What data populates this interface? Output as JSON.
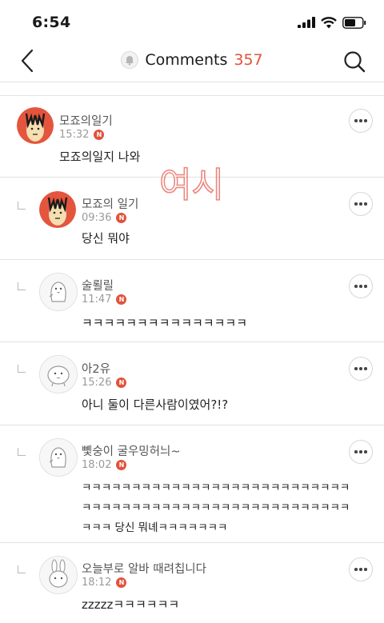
{
  "status": {
    "time": "6:54"
  },
  "header": {
    "title": "Comments",
    "count": "357"
  },
  "overlay_text": "여시",
  "comments": [
    {
      "nick": "모죠의일기",
      "time": "15:32",
      "text": "모죠의일지 나와",
      "reply": false,
      "avatar": "red-character"
    },
    {
      "nick": "모죠의 일기",
      "time": "09:36",
      "text": "당신 뭐야",
      "reply": true,
      "avatar": "red-character"
    },
    {
      "nick": "술뢸릴",
      "time": "11:47",
      "text": "ㅋㅋㅋㅋㅋㅋㅋㅋㅋㅋㅋㅋㅋㅋㅋ",
      "reply": true,
      "avatar": "penguin"
    },
    {
      "nick": "아2유",
      "time": "15:26",
      "text": "아니 둘이 다른사람이였어?!?",
      "reply": true,
      "avatar": "blob"
    },
    {
      "nick": "뼻숭이 굴우밍허늬~",
      "time": "18:02",
      "lines": [
        "ㅋㅋㅋㅋㅋㅋㅋㅋㅋㅋㅋㅋㅋㅋㅋㅋㅋㅋㅋㅋㅋㅋㅋㅋㅋㅋㅋ",
        "ㅋㅋㅋㅋㅋㅋㅋㅋㅋㅋㅋㅋㅋㅋㅋㅋㅋㅋㅋㅋㅋㅋㅋㅋㅋㅋㅋ",
        "ㅋㅋㅋ 당신 뭐녜ㅋㅋㅋㅋㅋㅋㅋ"
      ],
      "reply": true,
      "avatar": "penguin"
    },
    {
      "nick": "오늘부로 알바 때려칩니다",
      "time": "18:12",
      "text": "zzzzzㅋㅋㅋㅋㅋㅋ",
      "reply": true,
      "avatar": "rabbit"
    }
  ],
  "badge_letter": "N",
  "colors": {
    "accent": "#e2523a",
    "scribble": "#e8746a"
  }
}
